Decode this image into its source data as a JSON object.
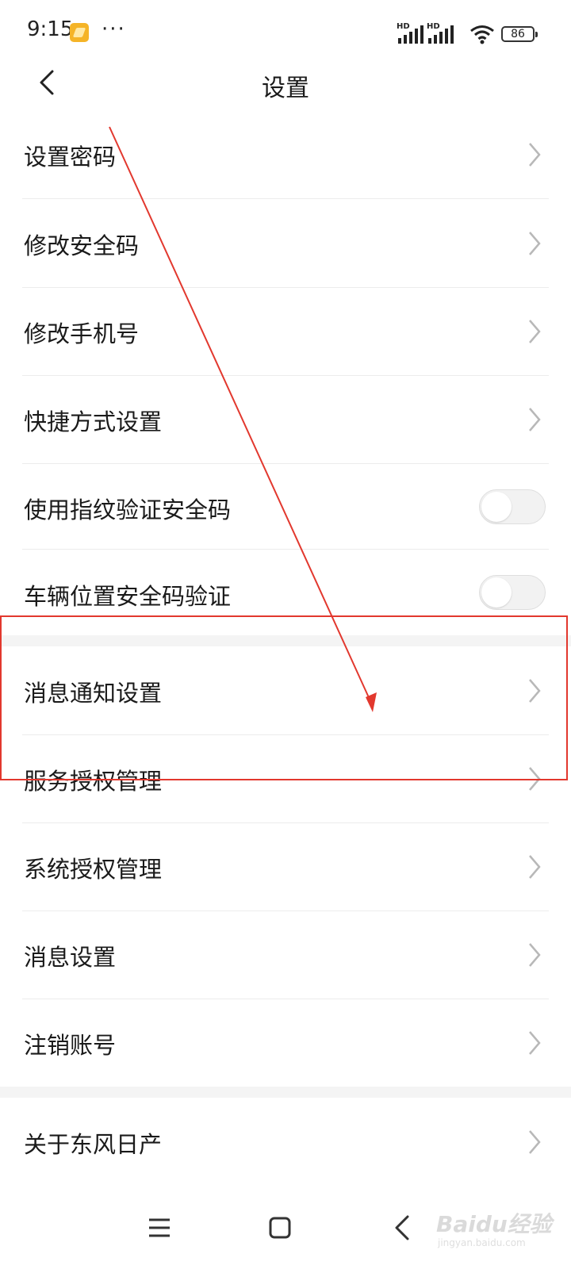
{
  "status_bar": {
    "time": "9:15",
    "dots": "···",
    "battery": "86",
    "hd1": "HD",
    "hd2": "HD"
  },
  "header": {
    "title": "设置"
  },
  "settings": {
    "set_password": "设置密码",
    "change_security_code": "修改安全码",
    "change_phone": "修改手机号",
    "shortcut_settings": "快捷方式设置",
    "fingerprint_verify": "使用指纹验证安全码",
    "vehicle_location_verify": "车辆位置安全码验证",
    "notification_settings": "消息通知设置",
    "service_auth": "服务授权管理",
    "system_auth": "系统授权管理",
    "message_settings": "消息设置",
    "delete_account": "注销账号",
    "about": "关于东风日产"
  },
  "toggles": {
    "fingerprint_verify": false,
    "vehicle_location_verify": false
  },
  "watermark": {
    "text": "Baidu经验",
    "sub": "jingyan.baidu.com"
  },
  "colors": {
    "annotation": "#e2382e",
    "divider": "#ececec",
    "section_gap": "#f4f4f4"
  },
  "icons": [
    "back-icon",
    "chevron-right-icon",
    "menu-icon",
    "home-icon",
    "back-nav-icon",
    "wifi-icon",
    "signal-icon",
    "battery-icon"
  ]
}
